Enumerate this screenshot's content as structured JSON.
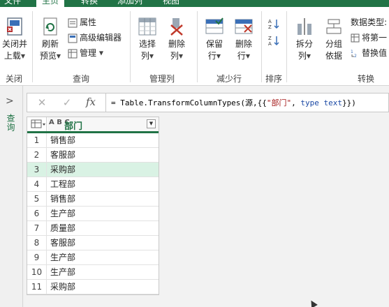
{
  "tabs": [
    "文件",
    "主页",
    "转换",
    "添加列",
    "视图"
  ],
  "ribbon": {
    "close_upload": [
      "关闭并",
      "上载"
    ],
    "refresh_preview": [
      "刷新",
      "预览"
    ],
    "properties": "属性",
    "advanced_editor": "高级编辑器",
    "manage": "管理",
    "choose_columns": [
      "选择",
      "列"
    ],
    "remove_columns": [
      "删除",
      "列"
    ],
    "keep_rows": [
      "保留",
      "行"
    ],
    "remove_rows": [
      "删除",
      "行"
    ],
    "split_column": [
      "拆分",
      "列"
    ],
    "group_by": [
      "分组",
      "依据"
    ],
    "data_type": "数据类型:",
    "use_first_row": "将第一",
    "replace_values": "替换值",
    "groups": {
      "close": "关闭",
      "query": "查询",
      "manage_columns": "管理列",
      "reduce_rows": "减少行",
      "sort": "排序",
      "transform": "转换"
    }
  },
  "querypane": {
    "label": "查询"
  },
  "formula": {
    "prefix": "= Table.TransformColumnTypes(源,{{",
    "string": "\"部门\"",
    "sep": ", ",
    "keyword": "type",
    "space": " ",
    "type_name": "text",
    "suffix": "}})"
  },
  "grid": {
    "type_icon": "A B C",
    "column_header": "部门",
    "rows": [
      {
        "n": "1",
        "v": "销售部"
      },
      {
        "n": "2",
        "v": "客服部"
      },
      {
        "n": "3",
        "v": "采购部"
      },
      {
        "n": "4",
        "v": "工程部"
      },
      {
        "n": "5",
        "v": "销售部"
      },
      {
        "n": "6",
        "v": "生产部"
      },
      {
        "n": "7",
        "v": "质量部"
      },
      {
        "n": "8",
        "v": "客服部"
      },
      {
        "n": "9",
        "v": "生产部"
      },
      {
        "n": "10",
        "v": "生产部"
      },
      {
        "n": "11",
        "v": "采购部"
      }
    ],
    "selected_row": 3
  },
  "colors": {
    "accent": "#217346",
    "selected_row": "#d9f2e4"
  }
}
